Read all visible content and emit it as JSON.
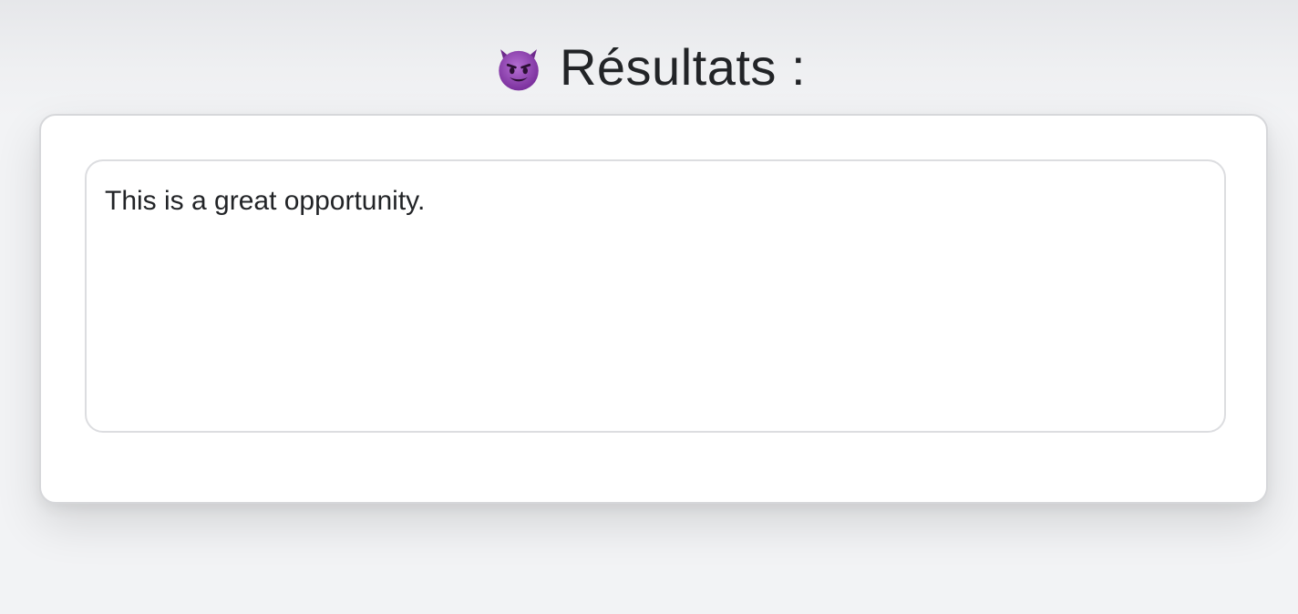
{
  "header": {
    "icon": "smiling-devil-icon",
    "title": "Résultats :"
  },
  "result": {
    "text": "This is a great opportunity."
  },
  "colors": {
    "background": "#f2f3f5",
    "card": "#ffffff",
    "border": "#d6d7da",
    "text": "#222427",
    "icon_purple": "#8e3fb0"
  }
}
